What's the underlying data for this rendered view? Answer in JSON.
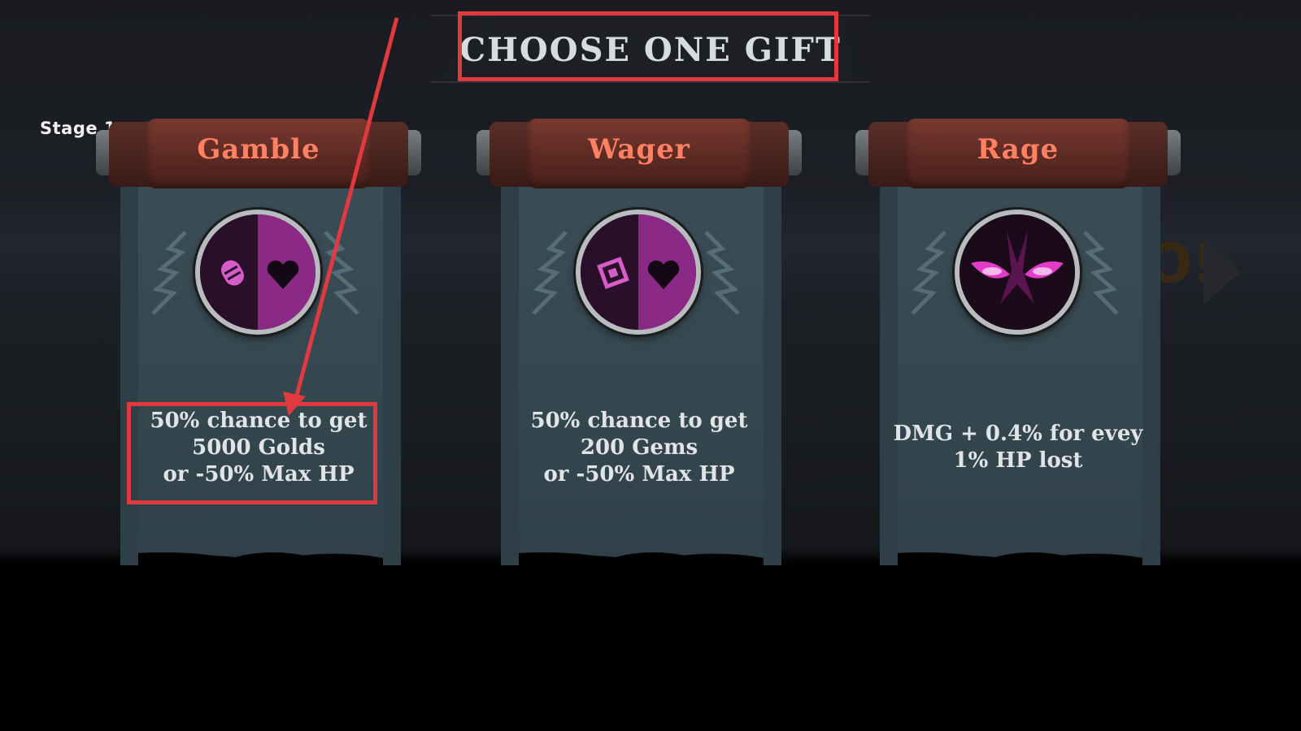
{
  "screen": {
    "title": "CHOOSE ONE GIFT",
    "stage_label": "Stage 1"
  },
  "gifts": [
    {
      "name": "Gamble",
      "icon": "gold-coin-and-heart-icon",
      "description_lines": [
        "50% chance to get",
        "5000 Golds",
        "or -50% Max HP"
      ]
    },
    {
      "name": "Wager",
      "icon": "gem-and-heart-icon",
      "description_lines": [
        "50% chance to get",
        "200 Gems",
        "or -50% Max HP"
      ]
    },
    {
      "name": "Rage",
      "icon": "rage-eyes-icon",
      "description_lines": [
        "DMG + 0.4% for evey",
        "1% HP lost"
      ]
    }
  ],
  "colors": {
    "card_title": "#ff8062",
    "annotation": "#e03a3e",
    "icon_accent": "#e23bc8"
  }
}
